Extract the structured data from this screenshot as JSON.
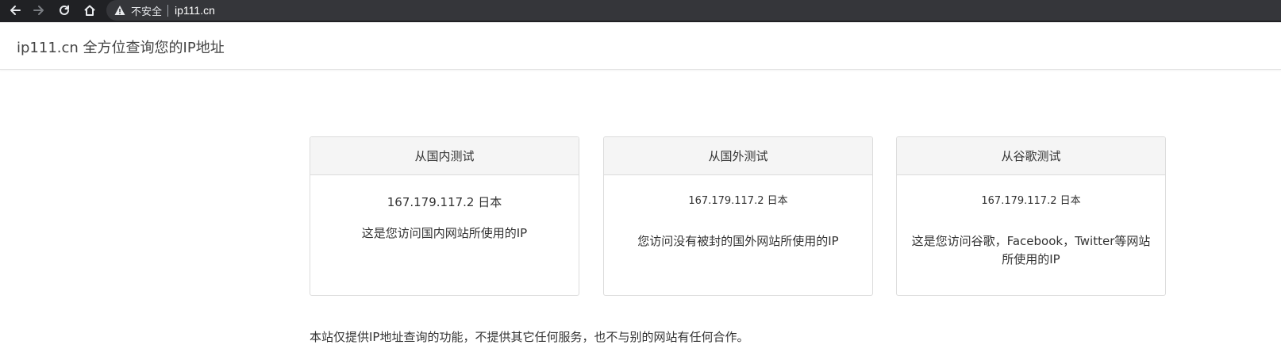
{
  "browser": {
    "security_label": "不安全",
    "url": "ip111.cn",
    "icons": {
      "back": "arrow-left-icon",
      "forward": "arrow-right-icon",
      "reload": "reload-icon",
      "home": "home-icon",
      "security": "warning-triangle-icon"
    }
  },
  "navbar": {
    "brand": "ip111.cn 全方位查询您的IP地址"
  },
  "cards": [
    {
      "title": "从国内测试",
      "ip": "167.179.117.2 日本",
      "description": "这是您访问国内网站所使用的IP"
    },
    {
      "title": "从国外测试",
      "ip": "167.179.117.2 日本",
      "description": "您访问没有被封的国外网站所使用的IP"
    },
    {
      "title": "从谷歌测试",
      "ip": "167.179.117.2 日本",
      "description": "这是您访问谷歌，Facebook，Twitter等网站所使用的IP"
    }
  ],
  "footer": {
    "note": "本站仅提供IP地址查询的功能，不提供其它任何服务，也不与别的网站有任何合作。"
  },
  "colors": {
    "browser_bar": "#202124",
    "omnibox": "#35363a",
    "card_header_bg": "#f5f5f5",
    "card_border": "#dcdcdc",
    "text": "#333333"
  }
}
